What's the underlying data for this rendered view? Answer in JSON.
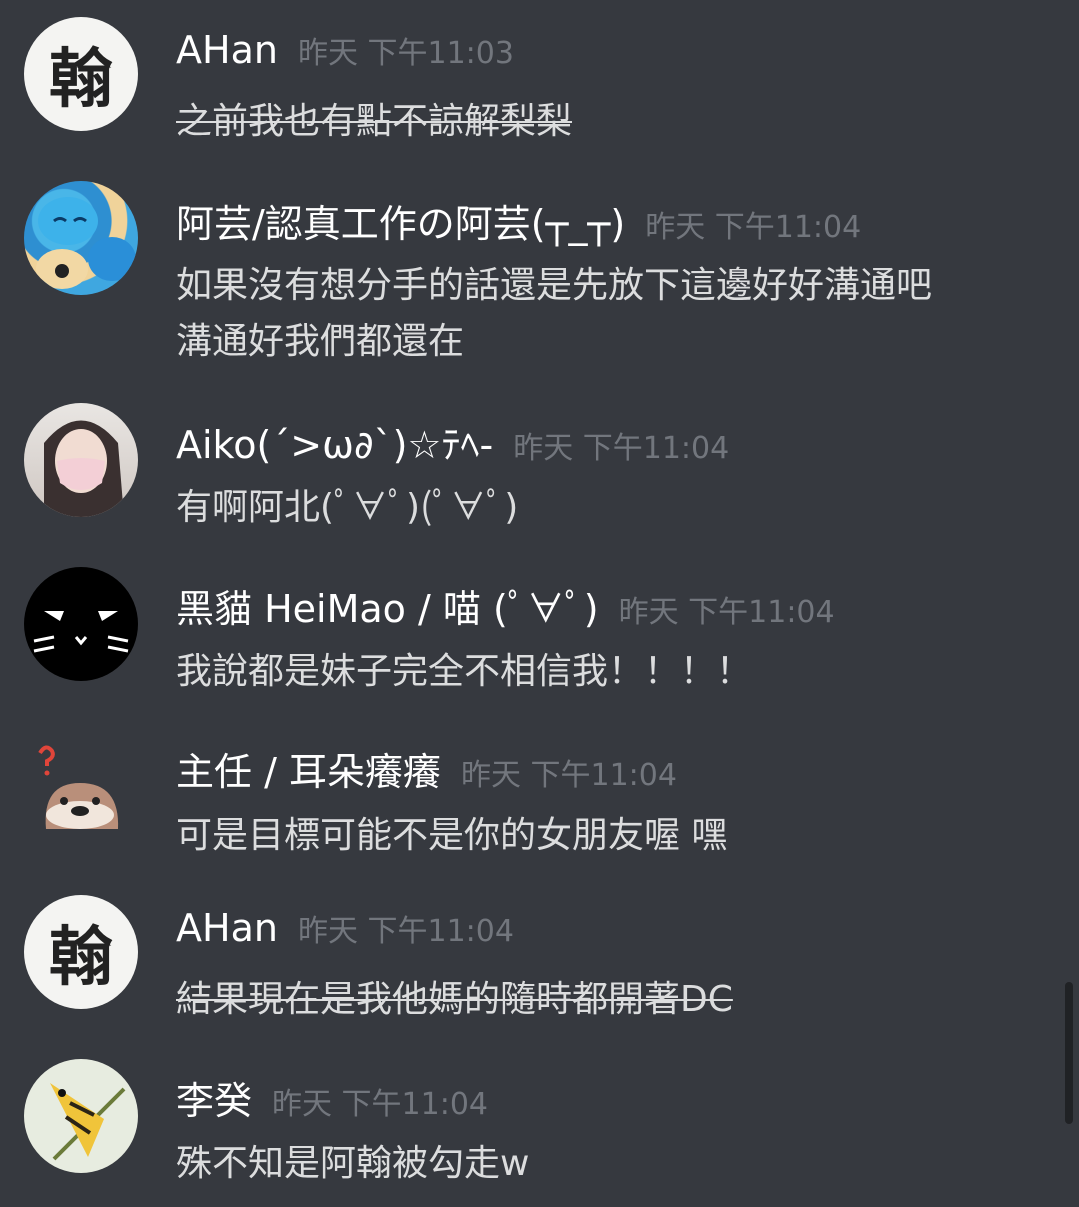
{
  "messages": [
    {
      "author": "AHan",
      "time": "昨天 下午11:03",
      "lines": [
        "之前我也有點不諒解梨梨"
      ],
      "strike": true,
      "avatar": "翰"
    },
    {
      "author": "阿芸/認真工作の阿芸(┬_┬)",
      "time": "昨天 下午11:04",
      "lines": [
        "如果沒有想分手的話還是先放下這邊好好溝通吧",
        "溝通好我們都還在"
      ],
      "strike": false
    },
    {
      "author": "Aiko(´>ω∂`)☆ﾃﾍ-",
      "time": "昨天 下午11:04",
      "lines": [
        "有啊阿北(ﾟ∀ﾟ)(ﾟ∀ﾟ)"
      ],
      "strike": false
    },
    {
      "author": "黑貓 HeiMao / 喵 (ﾟ∀ﾟ)",
      "time": "昨天 下午11:04",
      "lines": [
        "我說都是妹子完全不相信我！！！！"
      ],
      "strike": false
    },
    {
      "author": "主任 / 耳朵癢癢",
      "time": "昨天 下午11:04",
      "lines": [
        "可是目標可能不是你的女朋友喔 嘿"
      ],
      "strike": false
    },
    {
      "author": "AHan",
      "time": "昨天 下午11:04",
      "lines": [
        "結果現在是我他媽的隨時都開著DC"
      ],
      "strike": true,
      "avatar": "翰"
    },
    {
      "author": "李癸",
      "time": "昨天 下午11:04",
      "lines": [
        "殊不知是阿翰被勾走w"
      ],
      "strike": false
    }
  ]
}
